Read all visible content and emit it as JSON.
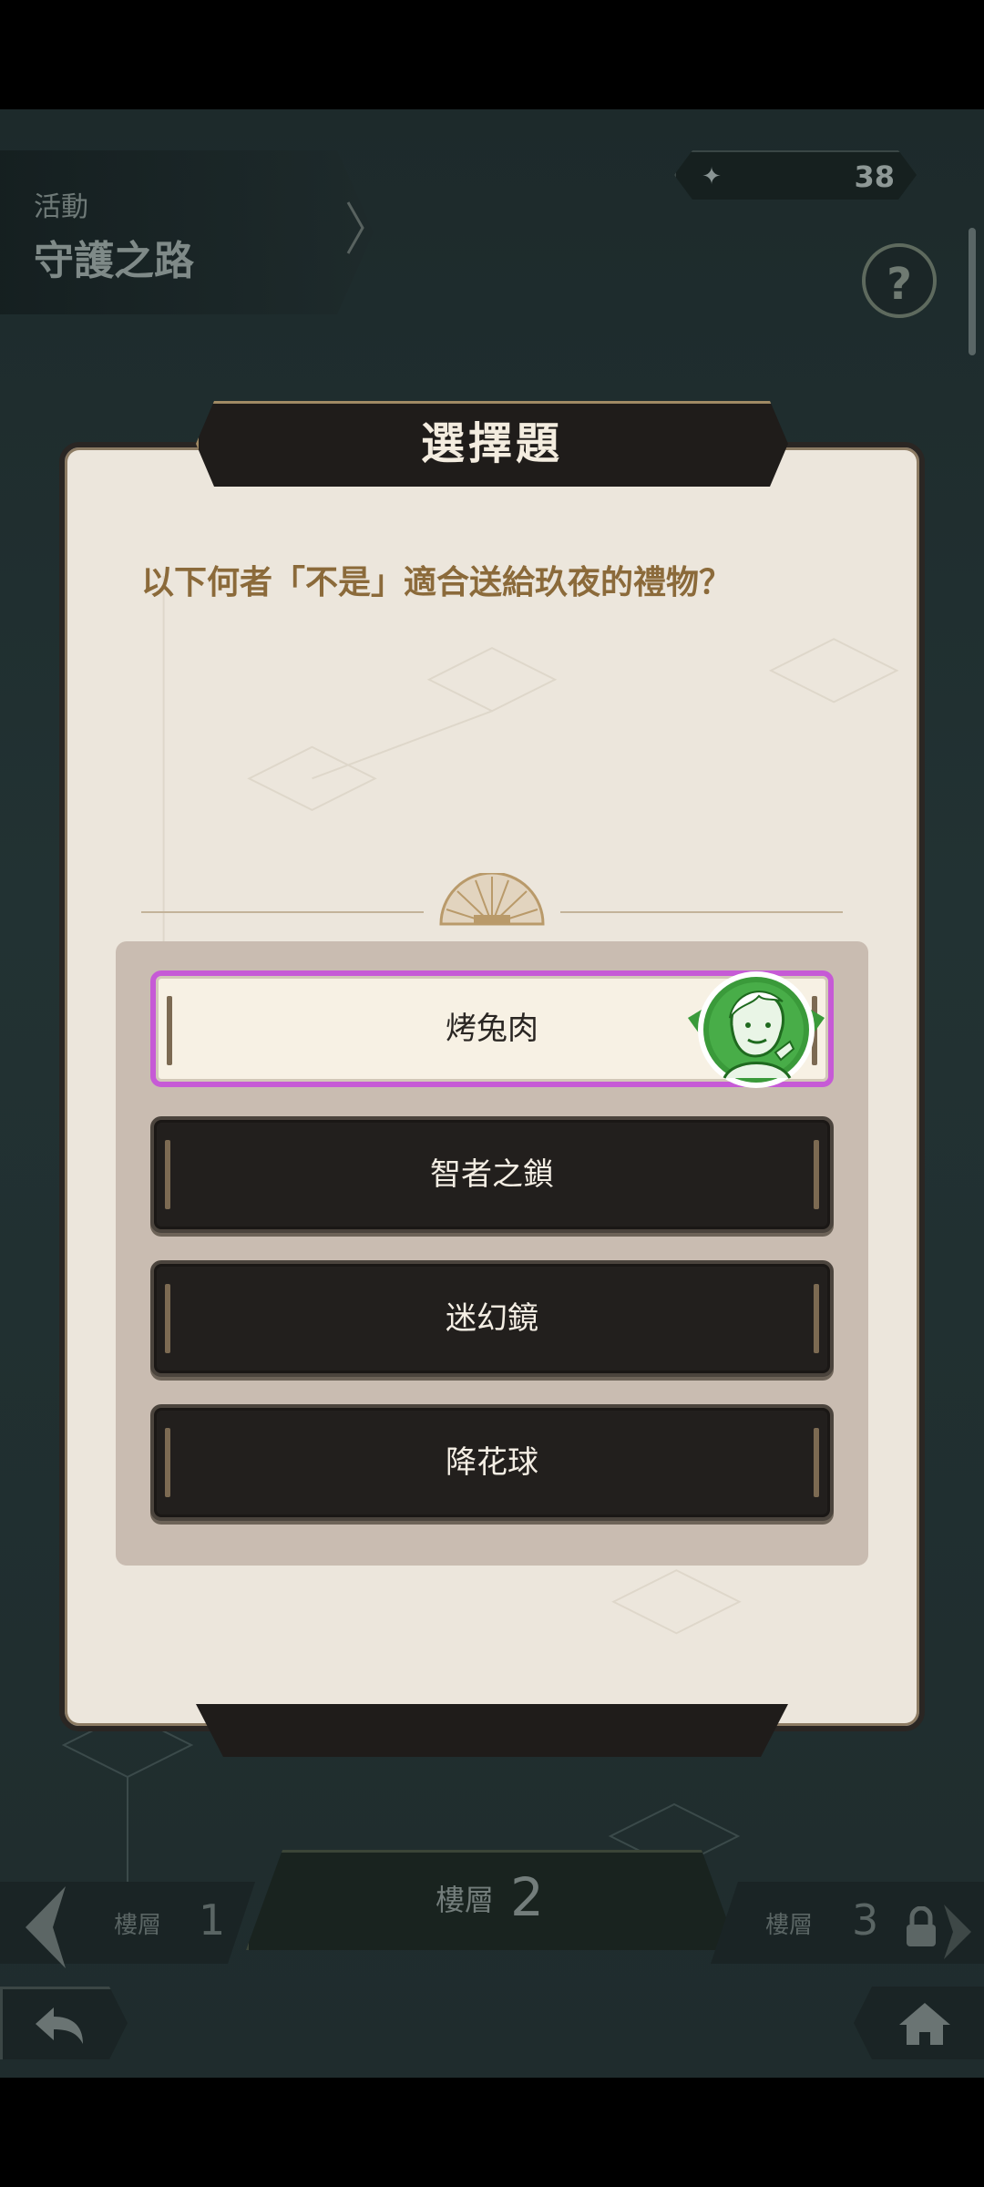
{
  "header": {
    "activity_label": "活動",
    "activity_title": "守護之路",
    "currency_icon": "sprite-icon",
    "currency_value": "38",
    "help_label": "?"
  },
  "dialog": {
    "title": "選擇題",
    "question": "以下何者「不是」適合送給玖夜的禮物？",
    "options": [
      {
        "label": "烤兔肉",
        "selected": true
      },
      {
        "label": "智者之鎖",
        "selected": false
      },
      {
        "label": "迷幻鏡",
        "selected": false
      },
      {
        "label": "降花球",
        "selected": false
      }
    ]
  },
  "floors": {
    "prev": {
      "label": "樓層",
      "number": "1"
    },
    "current": {
      "label": "樓層",
      "number": "2"
    },
    "next": {
      "label": "樓層",
      "number": "3"
    }
  },
  "colors": {
    "accent_selected": "#c65ad6",
    "question_text": "#8b6a3a",
    "badge_green": "#3a9a3a"
  }
}
